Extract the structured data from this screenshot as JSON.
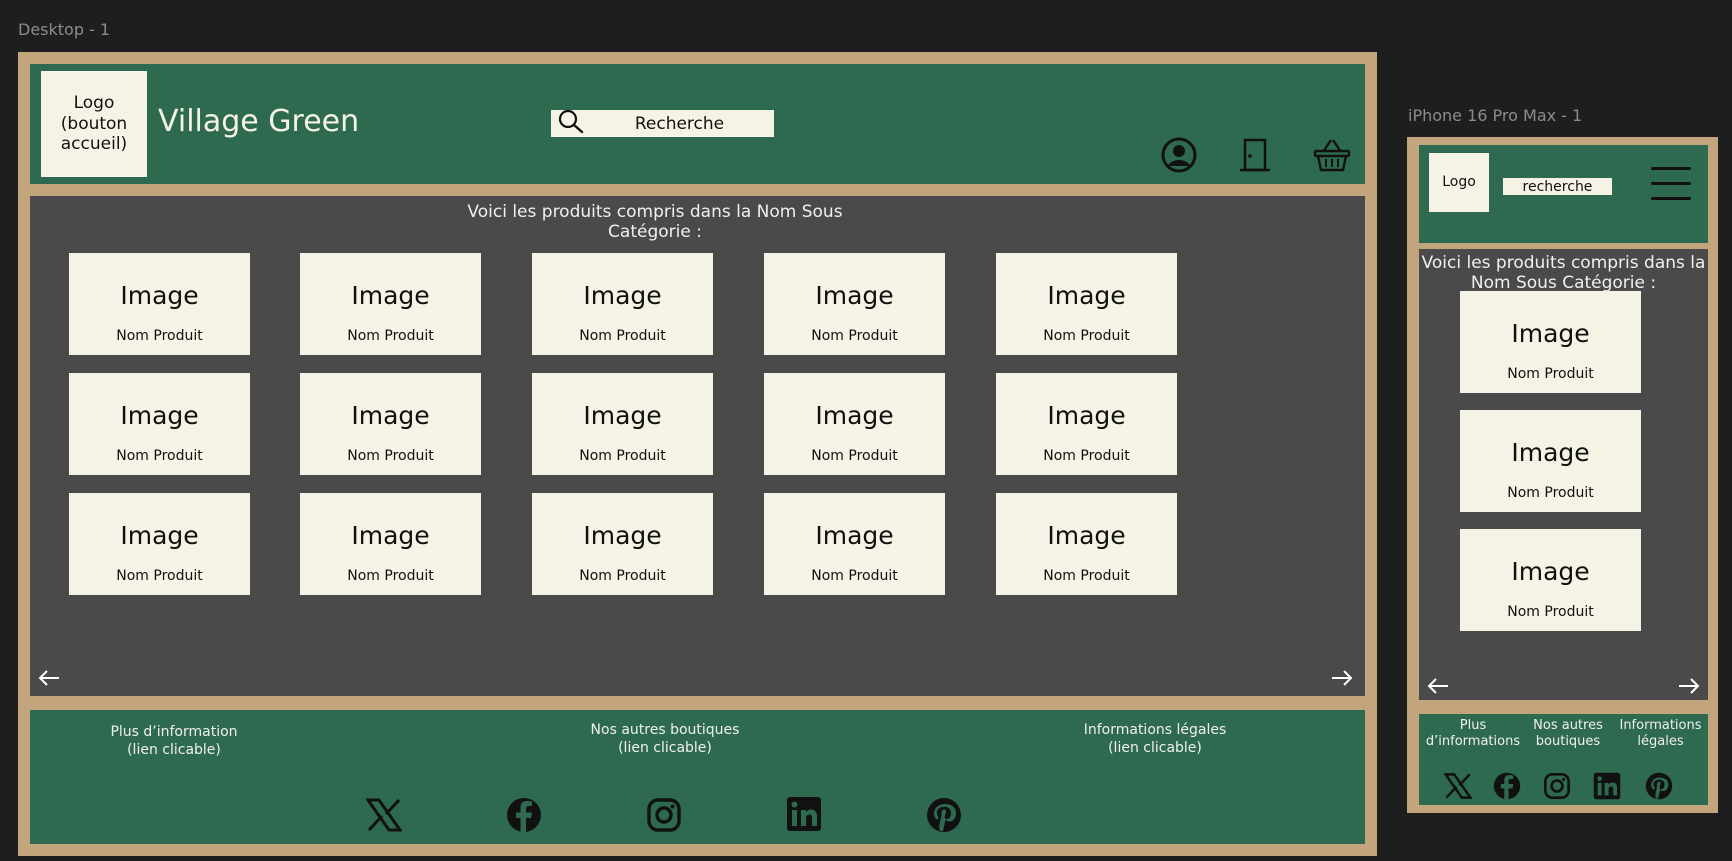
{
  "desktop": {
    "frame_label": "Desktop - 1",
    "header": {
      "logo_text": "Logo\n(bouton\naccueil)",
      "site_title": "Village Green",
      "search_placeholder": "Recherche",
      "icons": [
        "user-account-icon",
        "logout-door-icon",
        "shopping-basket-icon"
      ]
    },
    "main": {
      "intro_text": "Voici les produits compris dans la Nom Sous\nCatégorie :",
      "products": [
        {
          "image": "Image",
          "name": "Nom Produit"
        },
        {
          "image": "Image",
          "name": "Nom Produit"
        },
        {
          "image": "Image",
          "name": "Nom Produit"
        },
        {
          "image": "Image",
          "name": "Nom Produit"
        },
        {
          "image": "Image",
          "name": "Nom Produit"
        },
        {
          "image": "Image",
          "name": "Nom Produit"
        },
        {
          "image": "Image",
          "name": "Nom Produit"
        },
        {
          "image": "Image",
          "name": "Nom Produit"
        },
        {
          "image": "Image",
          "name": "Nom Produit"
        },
        {
          "image": "Image",
          "name": "Nom Produit"
        },
        {
          "image": "Image",
          "name": "Nom Produit"
        },
        {
          "image": "Image",
          "name": "Nom Produit"
        },
        {
          "image": "Image",
          "name": "Nom Produit"
        },
        {
          "image": "Image",
          "name": "Nom Produit"
        },
        {
          "image": "Image",
          "name": "Nom Produit"
        }
      ],
      "prev_icon": "arrow-left-icon",
      "next_icon": "arrow-right-icon"
    },
    "footer": {
      "links": [
        "Plus d’information\n(lien clicable)",
        "Nos autres boutiques\n(lien clicable)",
        "Informations légales\n(lien clicable)"
      ],
      "socials": [
        "x-icon",
        "facebook-icon",
        "instagram-icon",
        "linkedin-icon",
        "pinterest-icon"
      ]
    }
  },
  "mobile": {
    "frame_label": "iPhone 16 Pro Max - 1",
    "header": {
      "logo_text": "Logo",
      "search_placeholder": "recherche",
      "menu_icon": "hamburger-menu-icon"
    },
    "main": {
      "intro_text": "Voici les produits compris dans la\nNom Sous Catégorie :",
      "products": [
        {
          "image": "Image",
          "name": "Nom Produit"
        },
        {
          "image": "Image",
          "name": "Nom Produit"
        },
        {
          "image": "Image",
          "name": "Nom Produit"
        }
      ]
    },
    "footer": {
      "links": [
        "Plus\nd’informations",
        "Nos autres\nboutiques",
        "Informations\nlégales"
      ],
      "socials": [
        "x-icon",
        "facebook-icon",
        "instagram-icon",
        "linkedin-icon",
        "pinterest-icon"
      ]
    }
  },
  "colors": {
    "frame_tan": "#c2a57c",
    "header_green": "#2e6a4f",
    "content_gray": "#4a4a4a",
    "card_cream": "#f5f2e6",
    "canvas_dark": "#1e1e1e"
  }
}
